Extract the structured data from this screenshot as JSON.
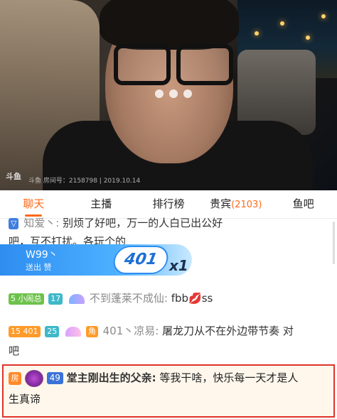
{
  "video": {
    "watermark": "斗鱼 房间号：2158798 | 2019.10.14",
    "logo": "斗鱼"
  },
  "tabs": [
    {
      "label": "聊天",
      "active": true
    },
    {
      "label": "主播"
    },
    {
      "label": "排行榜"
    },
    {
      "label": "贵宾",
      "count": "(2103)"
    },
    {
      "label": "鱼吧"
    }
  ],
  "chat": {
    "line1_name": "知爱丶:",
    "line1_text": "别烦了好吧，万一的人白已出公好",
    "line2_text": "吧，互不打扰。各玩个的",
    "gift": {
      "sender": "W99丶",
      "action": "送出 赞",
      "value": "401",
      "combo": "x1"
    },
    "msg3": {
      "badge1": "5 小闹总",
      "badge2": "17",
      "name": "不到蓬莱不成仙:",
      "text": "fbb💋ss"
    },
    "msg4": {
      "badge1": "15 401",
      "badge2": "25",
      "badge3": "角",
      "name": "401丶凉易:",
      "text": "屠龙刀从不在外边带节奏 对",
      "text2": "吧"
    },
    "msg5": {
      "house": "房",
      "level": "49",
      "name": "堂主刚出生的父亲:",
      "text": "等我干啥，快乐每一天才是人",
      "text2": "生真谛"
    }
  },
  "colors": {
    "accent": "#ff6a1a",
    "highlight_border": "#e0332b",
    "gift_blue": "#2e8df0"
  }
}
